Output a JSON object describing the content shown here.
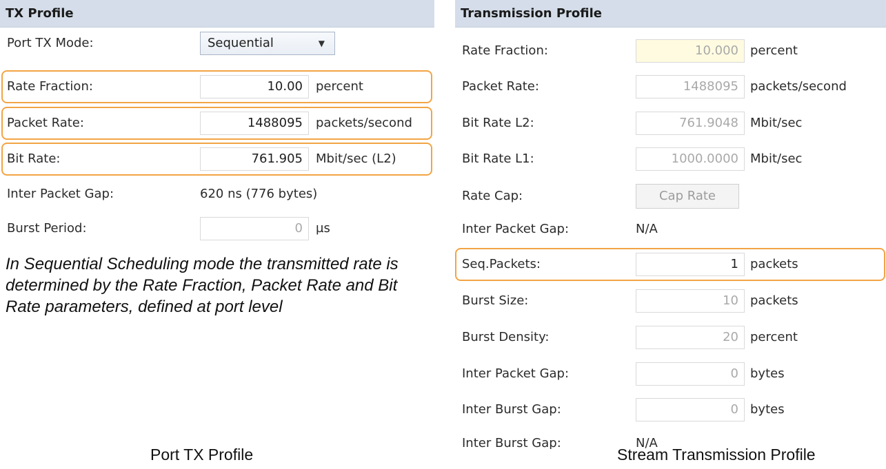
{
  "tx_profile": {
    "title": "TX Profile",
    "port_tx_mode": {
      "label": "Port TX Mode:",
      "value": "Sequential"
    },
    "rate_fraction": {
      "label": "Rate Fraction:",
      "value": "10.00",
      "unit": "percent"
    },
    "packet_rate": {
      "label": "Packet Rate:",
      "value": "1488095",
      "unit": "packets/second"
    },
    "bit_rate": {
      "label": "Bit Rate:",
      "value": "761.905",
      "unit": "Mbit/sec (L2)"
    },
    "inter_packet_gap": {
      "label": "Inter Packet Gap:",
      "value": "620 ns (776 bytes)"
    },
    "burst_period": {
      "label": "Burst Period:",
      "value": "0",
      "unit": "µs"
    },
    "note": "In Sequential Scheduling mode the transmitted rate is determined by the Rate Fraction, Packet Rate and Bit Rate parameters, defined at port level",
    "caption": "Port TX Profile"
  },
  "transmission_profile": {
    "title": "Transmission Profile",
    "rate_fraction": {
      "label": "Rate Fraction:",
      "value": "10.000",
      "unit": "percent"
    },
    "packet_rate": {
      "label": "Packet Rate:",
      "value": "1488095",
      "unit": "packets/second"
    },
    "bit_rate_l2": {
      "label": "Bit Rate L2:",
      "value": "761.9048",
      "unit": "Mbit/sec"
    },
    "bit_rate_l1": {
      "label": "Bit Rate L1:",
      "value": "1000.0000",
      "unit": "Mbit/sec"
    },
    "rate_cap": {
      "label": "Rate Cap:",
      "button": "Cap Rate"
    },
    "inter_packet_gap_info": {
      "label": "Inter Packet Gap:",
      "value": "N/A"
    },
    "seq_packets": {
      "label": "Seq.Packets:",
      "value": "1",
      "unit": "packets"
    },
    "burst_size": {
      "label": "Burst Size:",
      "value": "10",
      "unit": "packets"
    },
    "burst_density": {
      "label": "Burst Density:",
      "value": "20",
      "unit": "percent"
    },
    "inter_packet_gap": {
      "label": "Inter Packet Gap:",
      "value": "0",
      "unit": "bytes"
    },
    "inter_burst_gap": {
      "label": "Inter Burst Gap:",
      "value": "0",
      "unit": "bytes"
    },
    "inter_burst_gap_info": {
      "label": "Inter Burst Gap:",
      "value": "N/A"
    },
    "caption": "Stream Transmission Profile"
  },
  "colors": {
    "highlight": "#f2a444",
    "header_bg": "#d4dde9",
    "yellow_field": "#fffbe0"
  },
  "icons": {
    "dropdown": "chevron-down-icon"
  }
}
